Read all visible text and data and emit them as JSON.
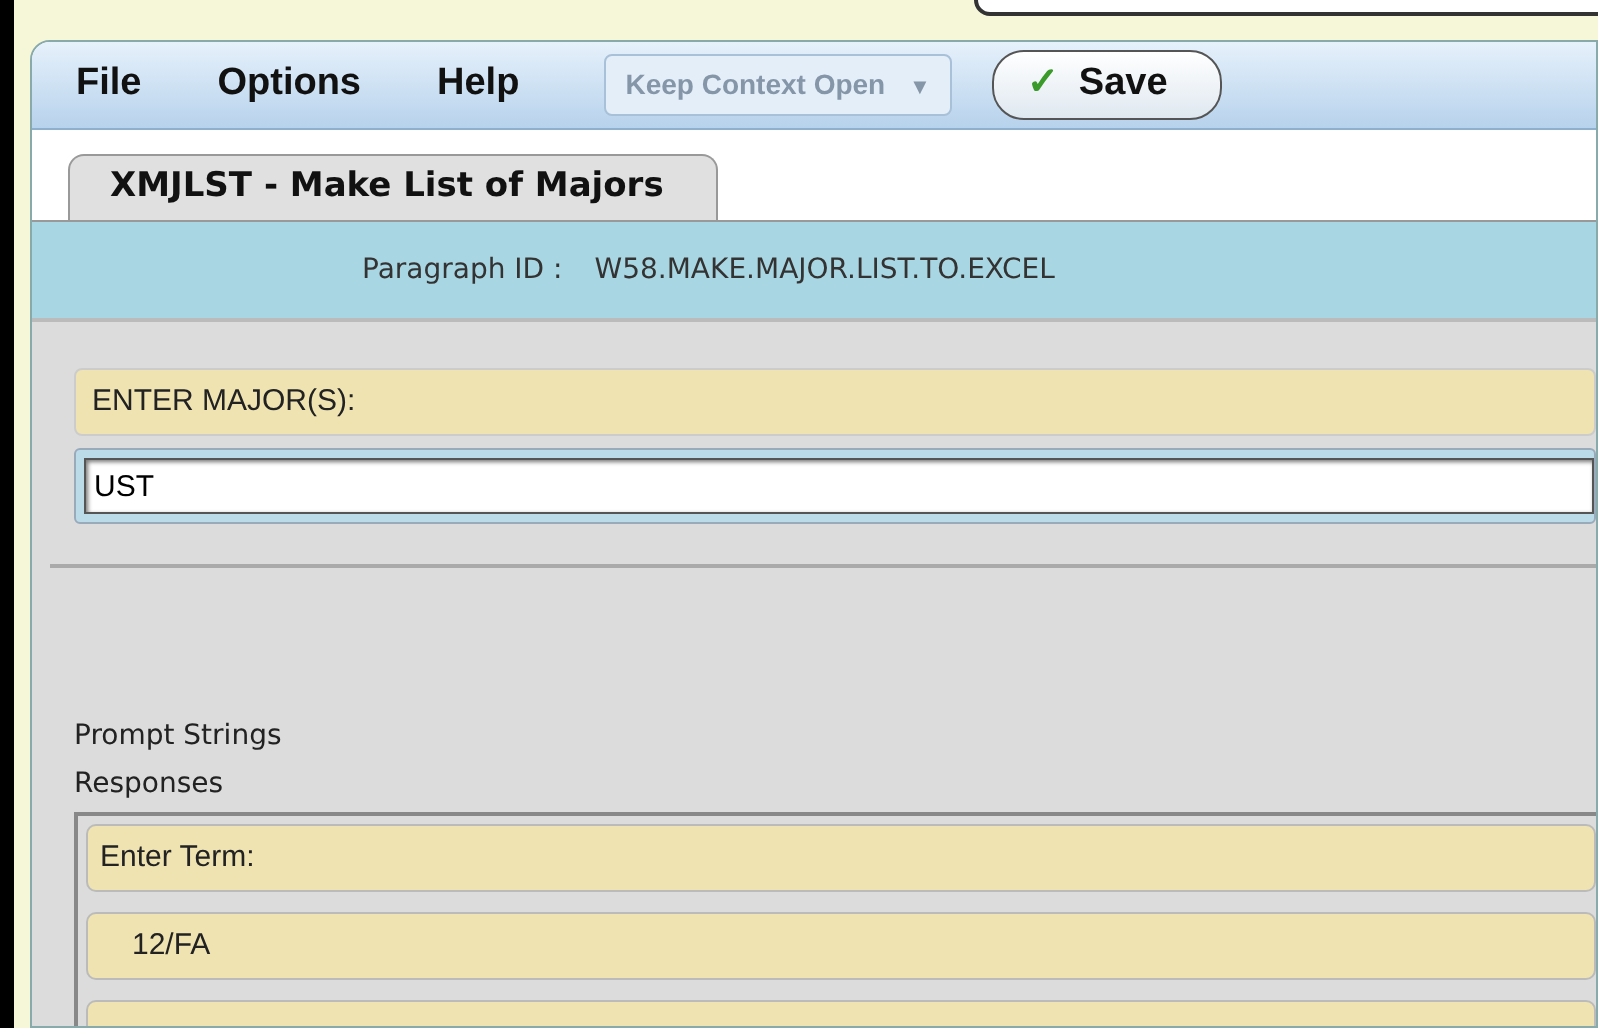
{
  "menu": [
    {
      "label": "File"
    },
    {
      "label": "Options"
    },
    {
      "label": "Help"
    }
  ],
  "context_dropdown": {
    "label": "Keep Context Open",
    "caret": "▼",
    "disabled": true
  },
  "save_button": {
    "label": "Save",
    "icon": "✓"
  },
  "tabs": [
    {
      "label": "XMJLST - Make List of Majors",
      "selected": true
    }
  ],
  "paragraph_id": {
    "label": "Paragraph ID :",
    "value": "W58.MAKE.MAJOR.LIST.TO.EXCEL"
  },
  "prompt": {
    "label": "ENTER MAJOR(S):",
    "value": "UST"
  },
  "section_labels": [
    "Prompt Strings",
    "Responses"
  ],
  "responses": [
    {
      "kind": "prompt",
      "text": "Enter Term:"
    },
    {
      "kind": "answer",
      "text": "12/FA"
    },
    {
      "kind": "prompt"
    }
  ]
}
